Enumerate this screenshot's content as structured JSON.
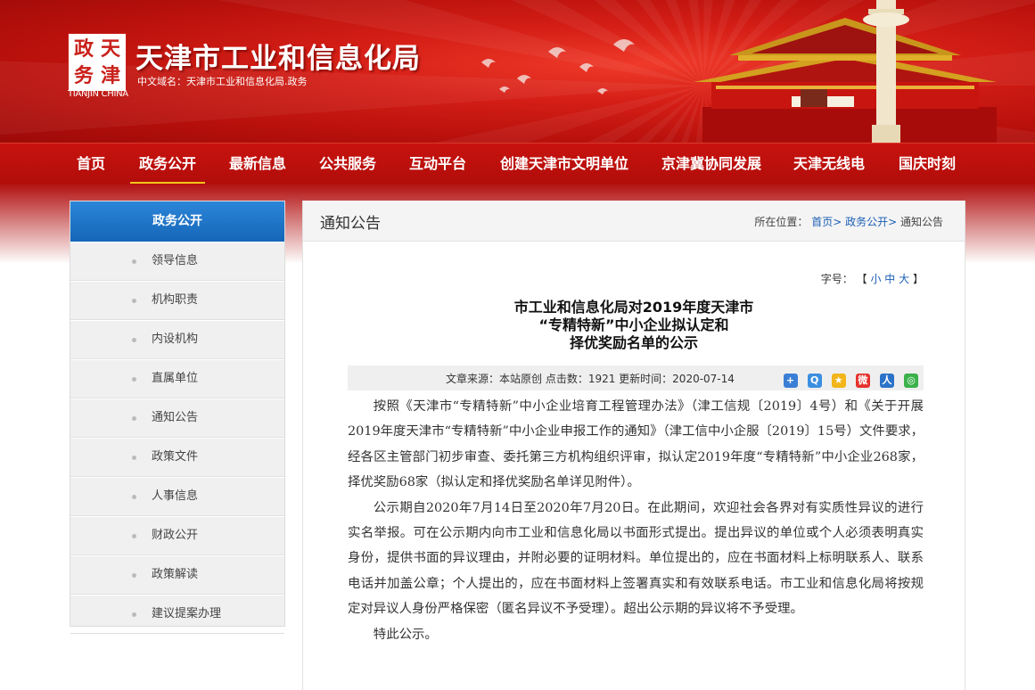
{
  "header": {
    "site_title": "天津市工业和信息化局",
    "domain_text": "中文域名：天津市工业和信息化局.政务",
    "logo_text": "TIANJIN CHINA",
    "logo_chars": [
      "天",
      "津",
      "政",
      "务"
    ]
  },
  "nav": {
    "items": [
      "首页",
      "政务公开",
      "最新信息",
      "公共服务",
      "互动平台",
      "创建天津市文明单位",
      "京津冀协同发展",
      "天津无线电",
      "国庆时刻"
    ],
    "active_index": 1
  },
  "sidebar": {
    "title": "政务公开",
    "items": [
      "领导信息",
      "机构职责",
      "内设机构",
      "直属单位",
      "通知公告",
      "政策文件",
      "人事信息",
      "财政公开",
      "政策解读",
      "建议提案办理"
    ]
  },
  "main": {
    "section_title": "通知公告",
    "breadcrumb": {
      "prefix": "所在位置：",
      "links": [
        "首页>",
        "政务公开>"
      ],
      "current": "通知公告"
    },
    "font_size": {
      "label": "字号：",
      "open": "【",
      "options": [
        "小",
        "中",
        "大"
      ],
      "close": "】"
    },
    "article": {
      "title_lines": [
        "市工业和信息化局对2019年度天津市",
        "“专精特新”中小企业拟认定和",
        "择优奖励名单的公示"
      ],
      "meta": "文章来源：本站原创 点击数：1921 更新时间：2020-07-14",
      "paragraphs": [
        "按照《天津市“专精特新”中小企业培育工程管理办法》（津工信规〔2019〕4号）和《关于开展2019年度天津市“专精特新”中小企业申报工作的通知》（津工信中小企服〔2019〕15号）文件要求，经各区主管部门初步审查、委托第三方机构组织评审，拟认定2019年度“专精特新”中小企业268家，择优奖励68家（拟认定和择优奖励名单详见附件）。",
        "公示期自2020年7月14日至2020年7月20日。在此期间，欢迎社会各界对有实质性异议的进行实名举报。可在公示期内向市工业和信息化局以书面形式提出。提出异议的单位或个人必须表明真实身份，提供书面的异议理由，并附必要的证明材料。单位提出的，应在书面材料上标明联系人、联系电话并加盖公章；个人提出的，应在书面材料上签署真实和有效联系电话。市工业和信息化局将按规定对异议人身份严格保密（匿名异议不予受理）。超出公示期的异议将不予受理。",
        "特此公示。"
      ]
    },
    "share_icons": [
      "plus-share-icon",
      "qzone-icon",
      "star-icon",
      "weibo-icon",
      "renren-icon",
      "wechat-icon"
    ]
  },
  "colors": {
    "brand_red": "#c8130f",
    "nav_underline": "#f3c51c",
    "sidebar_active": "#1566b8",
    "link_blue": "#1b5fb5"
  }
}
